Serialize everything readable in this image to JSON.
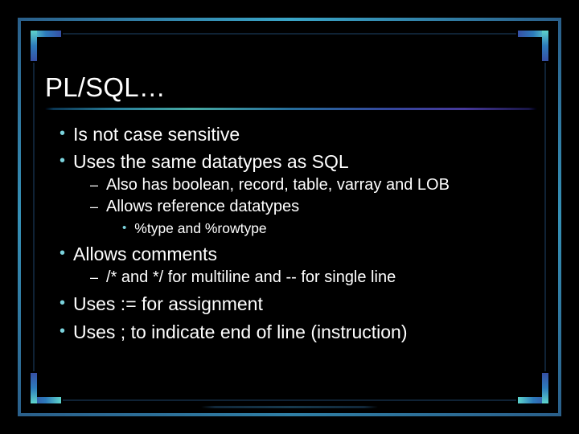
{
  "title": "PL/SQL…",
  "bullets": {
    "b1": "Is not case sensitive",
    "b2": "Uses the same datatypes as SQL",
    "b2_1": "Also has boolean, record, table, varray and LOB",
    "b2_2": "Allows reference datatypes",
    "b2_2_1": "%type and %rowtype",
    "b3": "Allows comments",
    "b3_1": "/* and */ for multiline and -- for single line",
    "b4": "Uses := for assignment",
    "b5": "Uses ; to indicate end of line (instruction)"
  },
  "markers": {
    "dot": "•",
    "dash": "–"
  },
  "colors": {
    "accent": "#7bd3dd",
    "text": "#ffffff",
    "background": "#000000"
  }
}
